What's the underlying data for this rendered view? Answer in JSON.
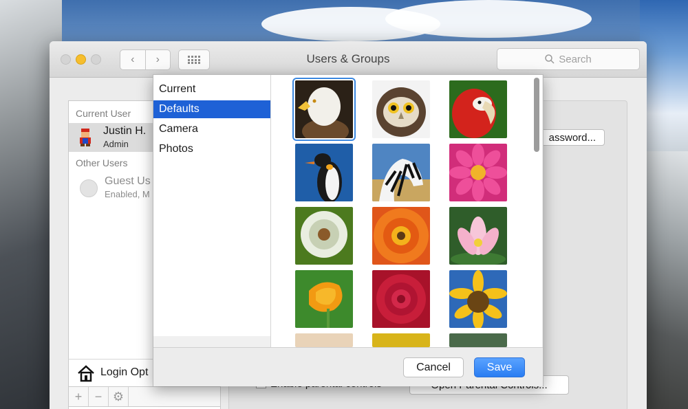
{
  "window": {
    "title": "Users & Groups",
    "search_placeholder": "Search"
  },
  "sidebar": {
    "current_user_label": "Current User",
    "current_user": {
      "name": "Justin H.",
      "role": "Admin"
    },
    "other_users_label": "Other Users",
    "guest": {
      "name": "Guest Us",
      "status": "Enabled, M"
    },
    "login_options_label": "Login Opt"
  },
  "main": {
    "password_button": "assword...",
    "parental_checkbox_label": "Enable parental controls",
    "parental_button": "Open Parental Controls..."
  },
  "picture_sheet": {
    "sources": [
      "Current",
      "Defaults",
      "Camera",
      "Photos"
    ],
    "selected_source": "Defaults",
    "pictures": [
      "eagle",
      "owl",
      "parrot",
      "penguin",
      "zebra",
      "pink-dahlia",
      "dandelion",
      "orange-gerbera",
      "lotus",
      "yellow-poppy",
      "red-rose",
      "sunflower"
    ],
    "selected_picture": "eagle",
    "cancel_label": "Cancel",
    "save_label": "Save"
  },
  "colors": {
    "accent": "#1e61d6",
    "save_button": "#2a7df2"
  }
}
